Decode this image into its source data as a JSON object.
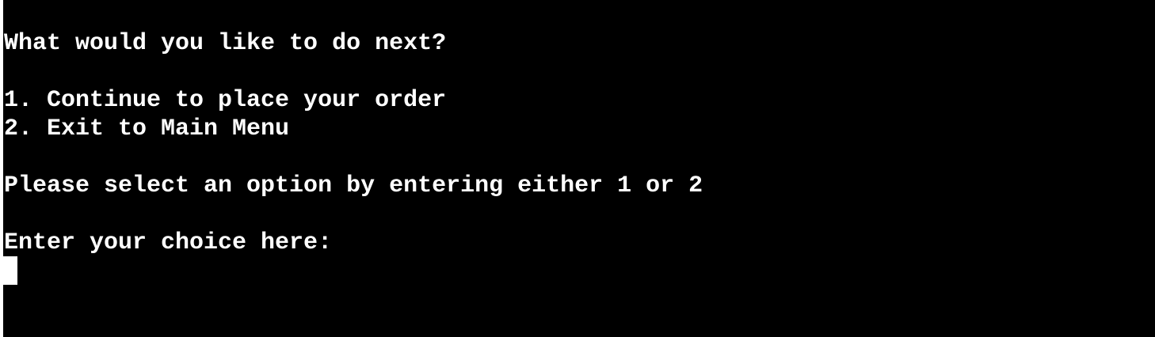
{
  "terminal": {
    "prompt_question": "What would you like to do next?",
    "options": [
      "1. Continue to place your order",
      "2. Exit to Main Menu"
    ],
    "instruction": "Please select an option by entering either 1 or 2",
    "input_prompt": "Enter your choice here:",
    "input_value": ""
  },
  "colors": {
    "background": "#000000",
    "text": "#ffffff",
    "cursor": "#ffffff"
  }
}
